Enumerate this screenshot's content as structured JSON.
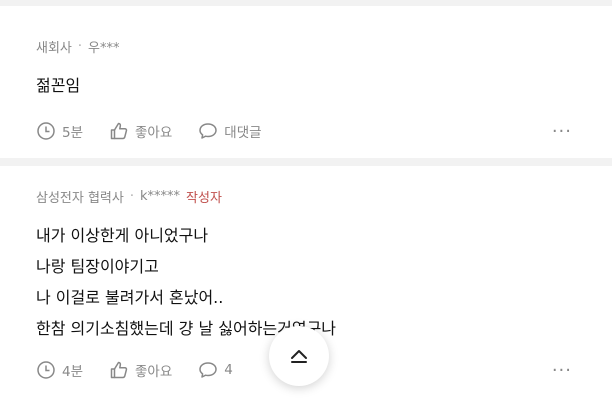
{
  "comments": [
    {
      "company": "새회사",
      "author": "우***",
      "is_op": false,
      "op_label": "",
      "lines": [
        "젊꼰임"
      ],
      "time": "5분",
      "like_label": "좋아요",
      "reply_label": "대댓글"
    },
    {
      "company": "삼성전자 협력사",
      "author": "k*****",
      "is_op": true,
      "op_label": "작성자",
      "lines": [
        "내가 이상한게 아니었구나",
        "나랑 팀장이야기고",
        "나 이걸로 불려가서 혼났어..",
        "한참 의기소침했는데 걍 날 싫어하는거였구나"
      ],
      "time": "4분",
      "like_label": "좋아요",
      "reply_label": "4"
    }
  ],
  "more_label": "···",
  "icons": {
    "time": "clock-icon",
    "like": "thumbs-up-icon",
    "reply": "speech-bubble-icon",
    "more": "more-dots-icon",
    "scroll_top": "chevron-up-icon"
  },
  "colors": {
    "meta_text": "#888888",
    "body_text": "#111111",
    "op_badge": "#c0504d",
    "separator": "#f2f2f2"
  }
}
